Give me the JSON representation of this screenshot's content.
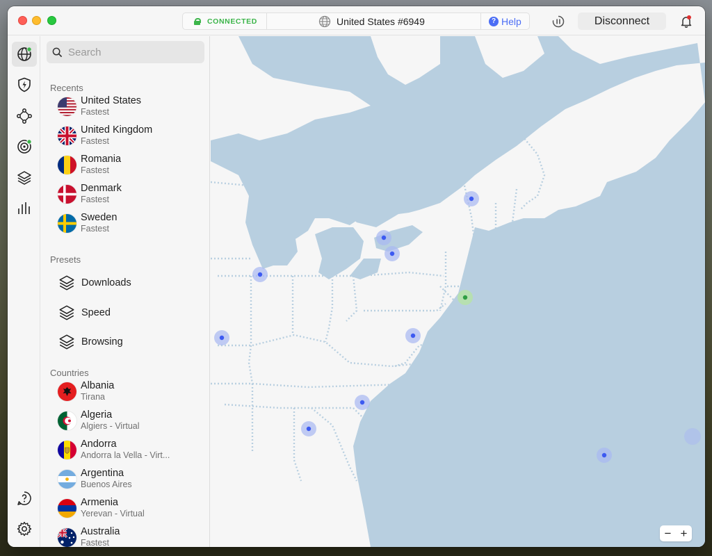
{
  "header": {
    "status_label": "CONNECTED",
    "server_name": "United States #6949",
    "help_label": "Help",
    "disconnect_label": "Disconnect"
  },
  "rail": {
    "icons": [
      "globe-icon",
      "shield-bolt-icon",
      "meshnet-icon",
      "threat-radar-icon",
      "layers-icon",
      "stats-bars-icon",
      "help-icon",
      "gear-icon"
    ]
  },
  "search": {
    "placeholder": "Search"
  },
  "recents": {
    "title": "Recents",
    "items": [
      {
        "name": "United States",
        "sub": "Fastest"
      },
      {
        "name": "United Kingdom",
        "sub": "Fastest"
      },
      {
        "name": "Romania",
        "sub": "Fastest"
      },
      {
        "name": "Denmark",
        "sub": "Fastest"
      },
      {
        "name": "Sweden",
        "sub": "Fastest"
      }
    ]
  },
  "presets": {
    "title": "Presets",
    "items": [
      {
        "name": "Downloads"
      },
      {
        "name": "Speed"
      },
      {
        "name": "Browsing"
      }
    ]
  },
  "countries": {
    "title": "Countries",
    "items": [
      {
        "name": "Albania",
        "sub": "Tirana"
      },
      {
        "name": "Algeria",
        "sub": "Algiers - Virtual"
      },
      {
        "name": "Andorra",
        "sub": "Andorra la Vella - Virt..."
      },
      {
        "name": "Argentina",
        "sub": "Buenos Aires"
      },
      {
        "name": "Armenia",
        "sub": "Yerevan - Virtual"
      },
      {
        "name": "Australia",
        "sub": "Fastest"
      }
    ]
  },
  "zoom": {
    "minus": "−",
    "plus": "+"
  },
  "colors": {
    "connected": "#3cb54a",
    "accent": "#4c6ef5",
    "water": "#b8cfe0",
    "land": "#f6f6f6",
    "pin": "#3d5af1"
  }
}
